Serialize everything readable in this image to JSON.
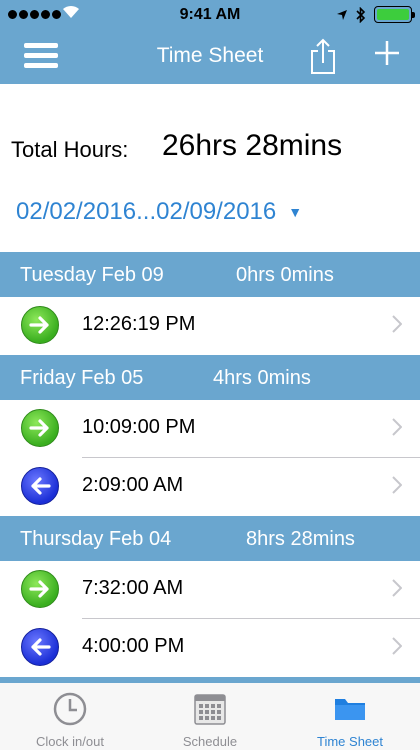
{
  "status_bar": {
    "time": "9:41 AM",
    "signal_icon": "signal-dots-icon",
    "wifi_icon": "wifi-icon",
    "location_icon": "location-arrow-icon",
    "bluetooth_icon": "bluetooth-icon",
    "battery_icon": "battery-icon",
    "battery_level": 1.0
  },
  "nav_bar": {
    "title": "Time Sheet",
    "menu_icon": "hamburger-menu-icon",
    "share_icon": "share-icon",
    "add_icon": "plus-icon"
  },
  "summary": {
    "total_label": "Total Hours:",
    "total_value": "26hrs 28mins",
    "date_range": "02/02/2016...02/09/2016",
    "date_caret": "▼"
  },
  "sections": [
    {
      "day": "Tuesday Feb 09",
      "hours": "0hrs 0mins",
      "entries": [
        {
          "type": "in",
          "time": "12:26:19 PM"
        }
      ]
    },
    {
      "day": "Friday Feb 05",
      "hours": "4hrs 0mins",
      "entries": [
        {
          "type": "in",
          "time": "10:09:00 PM"
        },
        {
          "type": "out",
          "time": "2:09:00 AM"
        }
      ]
    },
    {
      "day": "Thursday Feb 04",
      "hours": "8hrs 28mins",
      "entries": [
        {
          "type": "in",
          "time": "7:32:00 AM"
        },
        {
          "type": "out",
          "time": "4:00:00 PM"
        }
      ]
    }
  ],
  "tab_bar": {
    "tabs": [
      {
        "label": "Clock in/out",
        "icon": "clock-icon",
        "active": false
      },
      {
        "label": "Schedule",
        "icon": "calendar-icon",
        "active": false
      },
      {
        "label": "Time Sheet",
        "icon": "folder-icon",
        "active": true
      }
    ]
  },
  "colors": {
    "accent": "#6aa6cf",
    "link": "#2f84d2",
    "clock_in": "#3aae1f",
    "clock_out": "#1b2fd6"
  }
}
